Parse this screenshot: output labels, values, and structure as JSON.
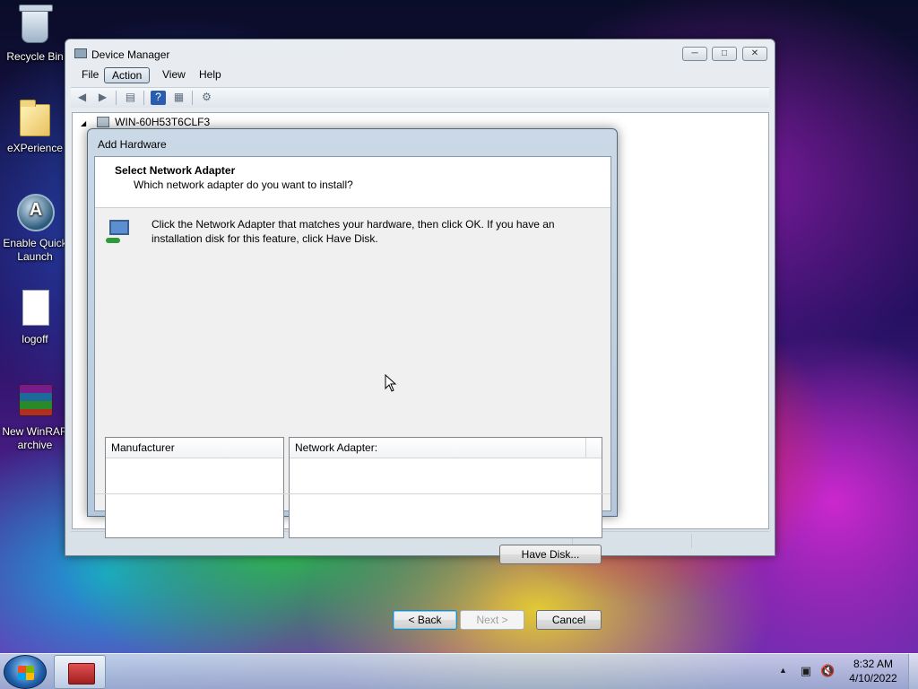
{
  "desktop": {
    "icons": [
      {
        "label": "Recycle Bin"
      },
      {
        "label": "eXPerience"
      },
      {
        "label": "Enable Quick Launch"
      },
      {
        "label": "logoff"
      },
      {
        "label": "New WinRAR archive"
      }
    ]
  },
  "device_manager": {
    "title": "Device Manager",
    "menu": [
      "File",
      "Action",
      "View",
      "Help"
    ],
    "active_menu": "Action",
    "tree_root": "WIN-60H53T6CLF3"
  },
  "add_hardware": {
    "title": "Add Hardware",
    "heading": "Select Network Adapter",
    "subheading": "Which network adapter do you want to install?",
    "instructions": "Click the Network Adapter that matches your hardware, then click OK. If you have an installation disk for this feature, click Have Disk.",
    "manufacturer_header": "Manufacturer",
    "adapter_header": "Network Adapter:",
    "have_disk_label": "Have Disk...",
    "back_label": "< Back",
    "next_label": "Next >",
    "cancel_label": "Cancel"
  },
  "taskbar": {
    "time": "8:32 AM",
    "date": "4/10/2022"
  },
  "colors": {
    "dialog_frame": "#cbd9e7",
    "focus_border": "#3c7fb1",
    "disabled_text": "#a0a0a0"
  }
}
